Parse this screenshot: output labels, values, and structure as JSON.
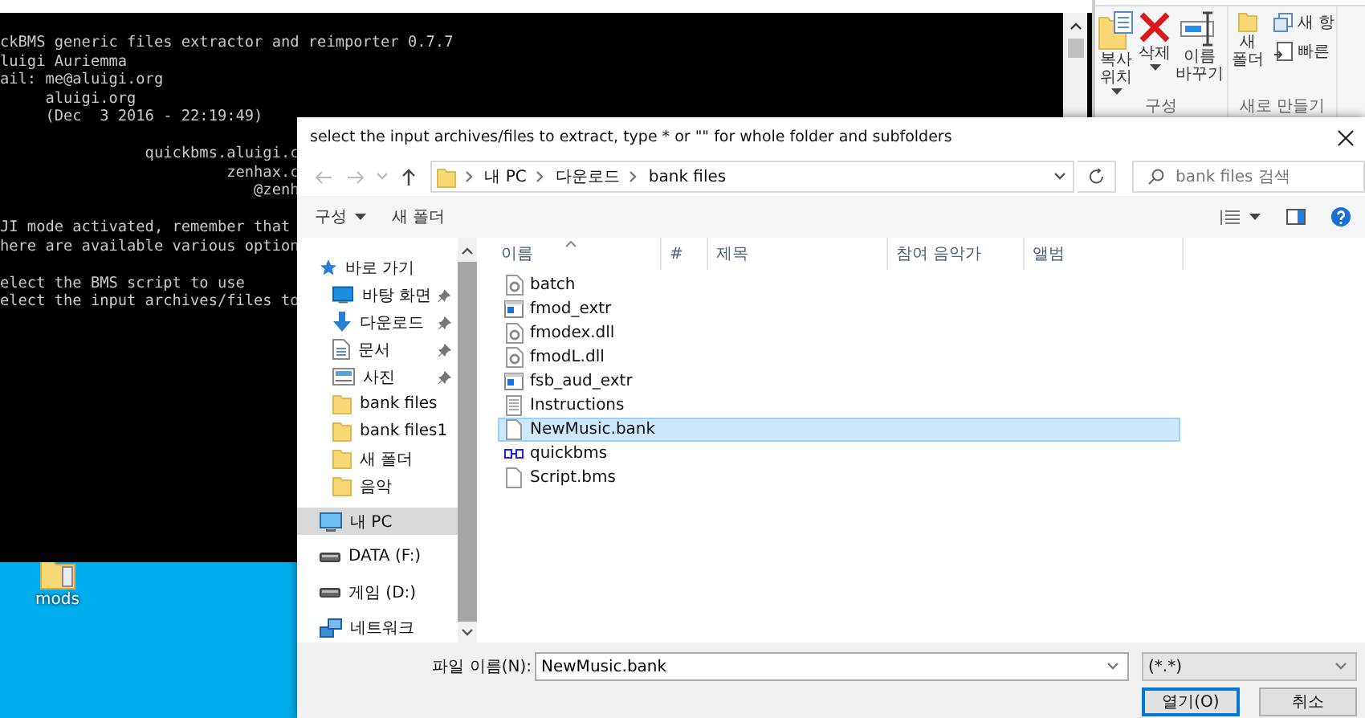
{
  "desktop": {
    "icons": [
      {
        "label": "mods"
      }
    ]
  },
  "console": {
    "blocks": [
      [
        "ckBMS generic files extractor and reimporter 0.7.7",
        "luigi Auriemma",
        "ail: me@aluigi.org",
        "     aluigi.org",
        "     (Dec  3 2016 - 22:19:49)"
      ],
      [
        "                quickbms.aluigi.c",
        "                         zenhax.c",
        "                            @zenh"
      ],
      [
        "JI mode activated, remember that",
        "here are available various option"
      ],
      [
        "elect the BMS script to use",
        "elect the input archives/files to"
      ]
    ]
  },
  "ribbon": {
    "groups": [
      {
        "label": "구성",
        "buttons": [
          {
            "label": "복사\n위치",
            "kind": "copy",
            "dropdown": true
          },
          {
            "label": "삭제",
            "kind": "delete",
            "dropdown": true
          },
          {
            "label": "이름\n바꾸기",
            "kind": "rename",
            "dropdown": false
          }
        ]
      },
      {
        "label": "새로 만들기",
        "buttons": [
          {
            "label": "새\n폴더",
            "kind": "folder",
            "dropdown": false
          }
        ],
        "small_buttons": [
          {
            "label": "새 항",
            "kind": "new-item"
          },
          {
            "label": "빠른",
            "kind": "quick"
          }
        ]
      }
    ]
  },
  "dialog": {
    "title": "select the input archives/files to extract, type * or \"\" for whole folder and subfolders",
    "address": [
      "내 PC",
      "다운로드",
      "bank files"
    ],
    "search": {
      "placeholder": "bank files 검색"
    },
    "toolbar": {
      "organize": "구성",
      "new_folder": "새 폴더"
    },
    "nav": [
      {
        "label": "바로 가기",
        "kind": "star",
        "selected": false,
        "children": [
          {
            "label": "바탕 화면",
            "kind": "desktop",
            "pinned": true,
            "selected": false
          },
          {
            "label": "다운로드",
            "kind": "download",
            "pinned": true,
            "selected": false
          },
          {
            "label": "문서",
            "kind": "document",
            "pinned": true,
            "selected": false
          },
          {
            "label": "사진",
            "kind": "picture",
            "pinned": true,
            "selected": false
          },
          {
            "label": "bank files",
            "kind": "folder",
            "pinned": false,
            "selected": false
          },
          {
            "label": "bank files1",
            "kind": "folder",
            "pinned": false,
            "selected": false
          },
          {
            "label": "새 폴더",
            "kind": "folder",
            "pinned": false,
            "selected": false
          },
          {
            "label": "음악",
            "kind": "folder",
            "pinned": false,
            "selected": false
          }
        ]
      },
      {
        "label": "내 PC",
        "kind": "pc",
        "selected": true
      },
      {
        "label": "DATA (F:)",
        "kind": "drive",
        "selected": false
      },
      {
        "label": "게임 (D:)",
        "kind": "drive",
        "selected": false
      },
      {
        "label": "네트워크",
        "kind": "network",
        "selected": false
      }
    ],
    "columns": [
      "이름",
      "#",
      "제목",
      "참여 음악가",
      "앨범"
    ],
    "files": [
      {
        "name": "batch",
        "kind": "settings",
        "selected": false
      },
      {
        "name": "fmod_extr",
        "kind": "program",
        "selected": false
      },
      {
        "name": "fmodex.dll",
        "kind": "settings",
        "selected": false
      },
      {
        "name": "fmodL.dll",
        "kind": "settings",
        "selected": false
      },
      {
        "name": "fsb_aud_extr",
        "kind": "program",
        "selected": false
      },
      {
        "name": "Instructions",
        "kind": "text",
        "selected": false
      },
      {
        "name": "NewMusic.bank",
        "kind": "blank",
        "selected": true
      },
      {
        "name": "quickbms",
        "kind": "app",
        "selected": false
      },
      {
        "name": "Script.bms",
        "kind": "blank",
        "selected": false
      }
    ],
    "filename": {
      "label": "파일 이름(N):",
      "value": "NewMusic.bank"
    },
    "filetype": "(*.*)",
    "buttons": [
      {
        "label": "열기(O)",
        "default": true
      },
      {
        "label": "취소",
        "default": false
      }
    ]
  }
}
